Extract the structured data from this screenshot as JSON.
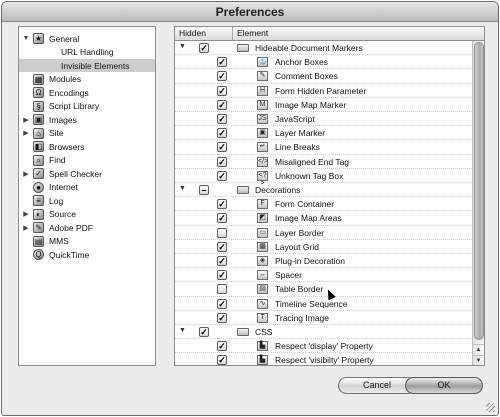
{
  "window": {
    "title": "Preferences"
  },
  "sidebar": {
    "items": [
      {
        "label": "General",
        "icon": "star-icon",
        "expanded": true
      },
      {
        "label": "URL Handling",
        "child": true
      },
      {
        "label": "Invisible Elements",
        "child": true,
        "selected": true
      },
      {
        "label": "Modules",
        "icon": "modules-icon"
      },
      {
        "label": "Encodings",
        "icon": "encodings-icon"
      },
      {
        "label": "Script Library",
        "icon": "script-library-icon"
      },
      {
        "label": "Images",
        "icon": "images-icon",
        "collapsed": true
      },
      {
        "label": "Site",
        "icon": "site-icon",
        "collapsed": true
      },
      {
        "label": "Browsers",
        "icon": "browsers-icon"
      },
      {
        "label": "Find",
        "icon": "find-icon"
      },
      {
        "label": "Spell Checker",
        "icon": "spell-checker-icon",
        "collapsed": true
      },
      {
        "label": "Internet",
        "icon": "internet-icon"
      },
      {
        "label": "Log",
        "icon": "log-icon"
      },
      {
        "label": "Source",
        "icon": "source-icon",
        "collapsed": true
      },
      {
        "label": "Adobe PDF",
        "icon": "adobe-pdf-icon",
        "collapsed": true
      },
      {
        "label": "MMS",
        "icon": "mms-icon"
      },
      {
        "label": "QuickTime",
        "icon": "quicktime-icon"
      }
    ]
  },
  "table": {
    "headers": {
      "hidden": "Hidden",
      "element": "Element"
    },
    "rows": [
      {
        "type": "group",
        "label": "Hideable Document Markers",
        "state": "checked"
      },
      {
        "type": "item",
        "label": "Anchor Boxes",
        "checked": true,
        "icon": "anchor-icon"
      },
      {
        "type": "item",
        "label": "Comment Boxes",
        "checked": true,
        "icon": "comment-icon"
      },
      {
        "type": "item",
        "label": "Form Hidden Parameter",
        "checked": true,
        "icon": "form-hidden-icon"
      },
      {
        "type": "item",
        "label": "Image Map Marker",
        "checked": true,
        "icon": "image-map-icon"
      },
      {
        "type": "item",
        "label": "JavaScript",
        "checked": true,
        "icon": "javascript-icon"
      },
      {
        "type": "item",
        "label": "Layer Marker",
        "checked": true,
        "icon": "layer-marker-icon"
      },
      {
        "type": "item",
        "label": "Line Breaks",
        "checked": true,
        "icon": "line-break-icon"
      },
      {
        "type": "item",
        "label": "Misaligned End Tag",
        "checked": true,
        "icon": "end-tag-icon"
      },
      {
        "type": "item",
        "label": "Unknown Tag Box",
        "checked": true,
        "icon": "unknown-tag-icon"
      },
      {
        "type": "group",
        "label": "Decorations",
        "state": "mixed"
      },
      {
        "type": "item",
        "label": "Form Container",
        "checked": true,
        "icon": "form-container-icon"
      },
      {
        "type": "item",
        "label": "Image Map Areas",
        "checked": true,
        "icon": "image-map-areas-icon"
      },
      {
        "type": "item",
        "label": "Layer Border",
        "checked": false,
        "icon": "layer-border-icon"
      },
      {
        "type": "item",
        "label": "Layout Grid",
        "checked": true,
        "icon": "layout-grid-icon"
      },
      {
        "type": "item",
        "label": "Plug-in Decoration",
        "checked": true,
        "icon": "plugin-icon"
      },
      {
        "type": "item",
        "label": "Spacer",
        "checked": true,
        "icon": "spacer-icon"
      },
      {
        "type": "item",
        "label": "Table Border",
        "checked": false,
        "icon": "table-border-icon"
      },
      {
        "type": "item",
        "label": "Timeline Sequence",
        "checked": true,
        "icon": "timeline-icon"
      },
      {
        "type": "item",
        "label": "Tracing Image",
        "checked": true,
        "icon": "tracing-image-icon"
      },
      {
        "type": "group",
        "label": "CSS",
        "state": "checked"
      },
      {
        "type": "item",
        "label": "Respect 'display' Property",
        "checked": true,
        "icon": "css-display-icon"
      },
      {
        "type": "item",
        "label": "Respect 'visibilty' Property",
        "checked": true,
        "icon": "css-visibility-icon"
      }
    ]
  },
  "buttons": {
    "cancel": "Cancel",
    "ok": "OK"
  }
}
